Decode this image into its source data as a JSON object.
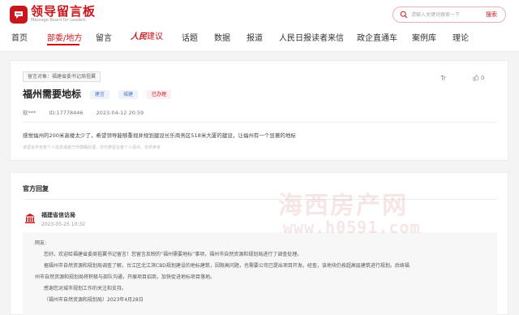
{
  "header": {
    "logo_title": "领导留言板",
    "logo_subtitle": "Message Board for Leaders",
    "search_placeholder": "请输入关键词搜索一下",
    "search_button": "搜索"
  },
  "nav": {
    "items": [
      {
        "label": "首页"
      },
      {
        "label": "部委/地方"
      },
      {
        "label": "留言"
      },
      {
        "label": "人民建议",
        "brand_part": "人民",
        "rest_part": "建议"
      },
      {
        "label": "话题"
      },
      {
        "label": "数据"
      },
      {
        "label": "报道"
      },
      {
        "label": "人民日报读者来信"
      },
      {
        "label": "政企直通车"
      },
      {
        "label": "案例库"
      },
      {
        "label": "理论"
      }
    ],
    "active": "部委/地方",
    "accent_color": "#c8161d"
  },
  "message": {
    "recipient": "留言对象：福建省委书记周祖翼",
    "title": "福州需要地标",
    "tags": [
      "建言",
      "城建",
      "已办理"
    ],
    "font_toggle": "Tr",
    "like_count": "0",
    "author": "软***",
    "id": "ID:17778446",
    "datetime": "2023-04-12 20:59",
    "body": "感觉福州的200米高楼太少了，希望领导能够重视并规划建设长乐商务区518米大厦的建设，让福州有一个显著的地标",
    "disclaimer": "该留言中含有个人信息或者已作模糊处理，仅代表留言者个人观点，仅供参考"
  },
  "reply": {
    "section_title": "官方回复",
    "org_name": "福建省信访局",
    "time": "2023-05-25 10:32",
    "paragraphs": [
      "网友:",
      "您好。欢迎给福建省委周祖翼书记留言！您留言反映的“福州需要地标”事项，福州市自然资源和规划局进行了调查处理。",
      "据福州市自然资源和规划局调查了解，台江区北江滨CBD规划建设的地标建筑，因限高问题，也需要公司已提出项目开发。经查，该地块仍按超高层建筑进行规划。后续福",
      "州市自然资源和规划局将积极与部队沟通，开展项目招商，加快促进地标项目落地。",
      "感谢您对城市规划工作的关注和支持。",
      "（福州市自然资源和规划局）2023年4月28日"
    ]
  },
  "watermark": {
    "text": "海西房产网",
    "url": "www.h0591.com"
  }
}
